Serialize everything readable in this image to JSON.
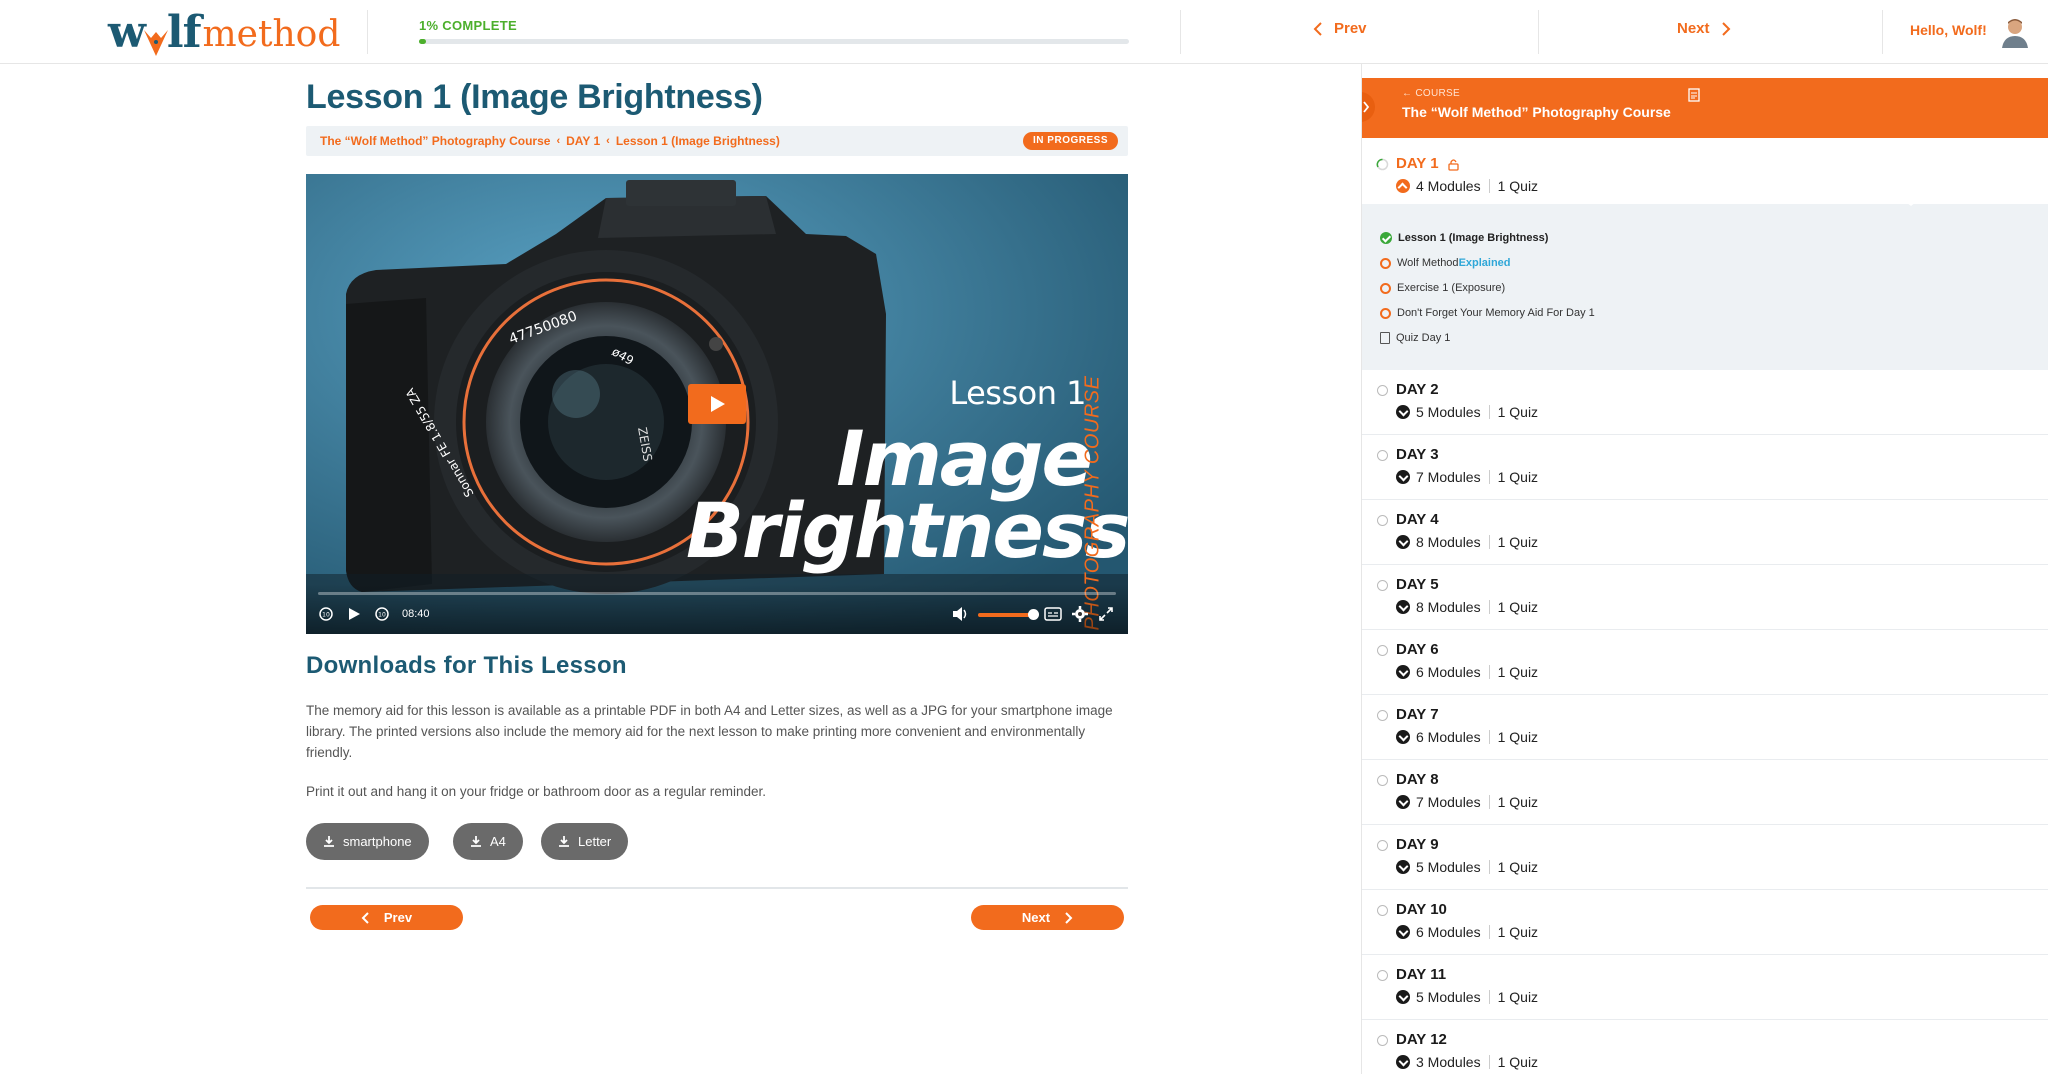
{
  "header": {
    "logo_wolf": "w",
    "logo_lf": "lf",
    "logo_method": "method",
    "progress_label": "1% COMPLETE",
    "progress_fraction": 0.01,
    "prev_label": "Prev",
    "next_label": "Next",
    "greeting": "Hello, Wolf!"
  },
  "lesson": {
    "title": "Lesson 1 (Image Brightness)",
    "breadcrumbs": [
      "The “Wolf Method” Photography Course",
      "DAY 1",
      "Lesson 1 (Image Brightness)"
    ],
    "status_badge": "IN PROGRESS"
  },
  "video": {
    "overlay_lesson": "Lesson 1",
    "overlay_title_1": "Image",
    "overlay_title_2": "Brightness",
    "overlay_vertical": "PHOTOGRAPHY COURSE",
    "lens_text_1": "47750080",
    "lens_text_2": "ø49",
    "lens_text_3": "ZEISS",
    "lens_text_4": "Sonnar FE 1.8/55 ZA",
    "time": "08:40",
    "volume_fraction": 0.85
  },
  "downloads": {
    "title": "Downloads for This Lesson",
    "paragraph_1": "The memory aid for this lesson is available as a printable PDF in both A4 and Letter sizes, as well as a JPG for your smartphone image library. The printed versions also include the memory aid for the next lesson to make printing more convenient and environmentally friendly.",
    "paragraph_2": "Print it out and hang it on your fridge or bathroom door as a regular reminder.",
    "buttons": [
      "smartphone",
      "A4",
      "Letter"
    ]
  },
  "footer_nav": {
    "prev": "Prev",
    "next": "Next"
  },
  "sidebar": {
    "small_label": "← COURSE",
    "course_title": "The “Wolf Method” Photography Course",
    "day1": {
      "name": "DAY 1",
      "modules": "4 Modules",
      "quiz": "1 Quiz",
      "items": [
        {
          "label": "Lesson 1 (Image Brightness)",
          "state": "done"
        },
        {
          "label_a": "Wolf Method",
          "label_b": "Explained",
          "state": "open"
        },
        {
          "label": "Exercise 1 (Exposure)",
          "state": "open"
        },
        {
          "label": "Don't Forget Your Memory Aid For Day 1",
          "state": "open"
        },
        {
          "label": "Quiz Day 1",
          "state": "quiz"
        }
      ]
    },
    "days": [
      {
        "name": "DAY 2",
        "modules": "5 Modules",
        "quiz": "1 Quiz"
      },
      {
        "name": "DAY 3",
        "modules": "7 Modules",
        "quiz": "1 Quiz"
      },
      {
        "name": "DAY 4",
        "modules": "8 Modules",
        "quiz": "1 Quiz"
      },
      {
        "name": "DAY 5",
        "modules": "8 Modules",
        "quiz": "1 Quiz"
      },
      {
        "name": "DAY 6",
        "modules": "6 Modules",
        "quiz": "1 Quiz"
      },
      {
        "name": "DAY 7",
        "modules": "6 Modules",
        "quiz": "1 Quiz"
      },
      {
        "name": "DAY 8",
        "modules": "7 Modules",
        "quiz": "1 Quiz"
      },
      {
        "name": "DAY 9",
        "modules": "5 Modules",
        "quiz": "1 Quiz"
      },
      {
        "name": "DAY 10",
        "modules": "6 Modules",
        "quiz": "1 Quiz"
      },
      {
        "name": "DAY 11",
        "modules": "5 Modules",
        "quiz": "1 Quiz"
      },
      {
        "name": "DAY 12",
        "modules": "3 Modules",
        "quiz": "1 Quiz"
      }
    ]
  },
  "colors": {
    "accent": "#f26b1d",
    "brand_blue": "#1c5a73",
    "progress_green": "#4caf2c"
  },
  "icons": [
    "chevron-left-icon",
    "chevron-right-icon",
    "avatar",
    "play-icon",
    "rewind-icon",
    "forward-icon",
    "volume-icon",
    "captions-icon",
    "settings-icon",
    "fullscreen-icon",
    "download-icon",
    "lock-icon",
    "document-icon",
    "check-circle-icon"
  ]
}
